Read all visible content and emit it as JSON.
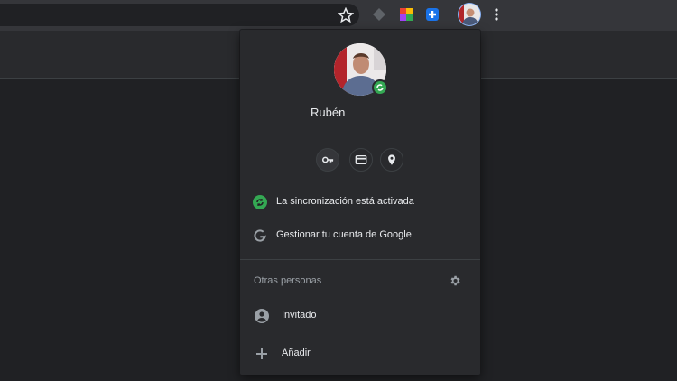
{
  "profile_menu": {
    "user_name": "Rubén",
    "sync_status": "La sincronización está activada",
    "manage_account": "Gestionar tu cuenta de Google",
    "other_people_title": "Otras personas",
    "guest_label": "Invitado",
    "add_label": "Añadir"
  },
  "icons": {
    "bookmark": "star-icon",
    "quick_actions": [
      "key-icon",
      "credit-card-icon",
      "location-pin-icon"
    ],
    "sync": "sync-icon",
    "google": "google-g-icon",
    "settings": "gear-icon",
    "guest": "account-circle-icon",
    "add": "plus-icon",
    "menu": "more-vert-icon"
  },
  "colors": {
    "panel_bg": "#292a2d",
    "toolbar_bg": "#35363a",
    "page_bg": "#202124",
    "sync_green": "#34a853",
    "text_primary": "#e8eaed",
    "text_secondary": "#9aa0a6"
  }
}
